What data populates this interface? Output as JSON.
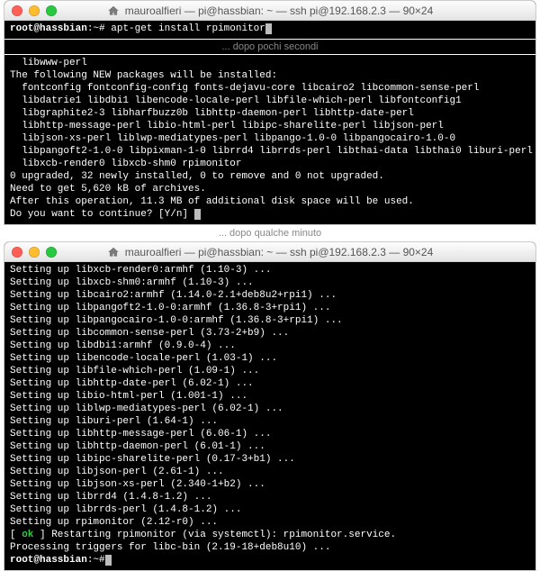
{
  "caption1": "... dopo pochi secondi",
  "caption2": "... dopo qualche minuto",
  "title1": "mauroalfieri — pi@hassbian: ~ — ssh pi@192.168.2.3 — 90×24",
  "title2": "mauroalfieri — pi@hassbian: ~ — ssh pi@192.168.2.3 — 90×24",
  "t1": {
    "prompt_user": "root@hassbian",
    "prompt_path": ":~#",
    "cmd": "apt-get install rpimonitor",
    "pkg_tail": "  libwww-perl",
    "new_hdr": "The following NEW packages will be installed:",
    "new1": "  fontconfig fontconfig-config fonts-dejavu-core libcairo2 libcommon-sense-perl",
    "new2": "  libdatrie1 libdbi1 libencode-locale-perl libfile-which-perl libfontconfig1",
    "new3": "  libgraphite2-3 libharfbuzz0b libhttp-daemon-perl libhttp-date-perl",
    "new4": "  libhttp-message-perl libio-html-perl libipc-sharelite-perl libjson-perl",
    "new5": "  libjson-xs-perl liblwp-mediatypes-perl libpango-1.0-0 libpangocairo-1.0-0",
    "new6": "  libpangoft2-1.0-0 libpixman-1-0 librrd4 librrds-perl libthai-data libthai0 liburi-perl",
    "new7": "  libxcb-render0 libxcb-shm0 rpimonitor",
    "upg": "0 upgraded, 32 newly installed, 0 to remove and 0 not upgraded.",
    "need": "Need to get 5,620 kB of archives.",
    "after": "After this operation, 11.3 MB of additional disk space will be used.",
    "cont": "Do you want to continue? [Y/n] "
  },
  "t2": {
    "l1": "Setting up libxcb-render0:armhf (1.10-3) ...",
    "l2": "Setting up libxcb-shm0:armhf (1.10-3) ...",
    "l3": "Setting up libcairo2:armhf (1.14.0-2.1+deb8u2+rpi1) ...",
    "l4": "Setting up libpangoft2-1.0-0:armhf (1.36.8-3+rpi1) ...",
    "l5": "Setting up libpangocairo-1.0-0:armhf (1.36.8-3+rpi1) ...",
    "l6": "Setting up libcommon-sense-perl (3.73-2+b9) ...",
    "l7": "Setting up libdbi1:armhf (0.9.0-4) ...",
    "l8": "Setting up libencode-locale-perl (1.03-1) ...",
    "l9": "Setting up libfile-which-perl (1.09-1) ...",
    "l10": "Setting up libhttp-date-perl (6.02-1) ...",
    "l11": "Setting up libio-html-perl (1.001-1) ...",
    "l12": "Setting up liblwp-mediatypes-perl (6.02-1) ...",
    "l13": "Setting up liburi-perl (1.64-1) ...",
    "l14": "Setting up libhttp-message-perl (6.06-1) ...",
    "l15": "Setting up libhttp-daemon-perl (6.01-1) ...",
    "l16": "Setting up libipc-sharelite-perl (0.17-3+b1) ...",
    "l17": "Setting up libjson-perl (2.61-1) ...",
    "l18": "Setting up libjson-xs-perl (2.340-1+b2) ...",
    "l19": "Setting up librrd4 (1.4.8-1.2) ...",
    "l20": "Setting up librrds-perl (1.4.8-1.2) ...",
    "l21": "Setting up rpimonitor (2.12-r0) ...",
    "restart_a": "[ ",
    "restart_ok": "ok",
    "restart_b": " ] Restarting rpimonitor (via systemctl): rpimonitor.service.",
    "trig": "Processing triggers for libc-bin (2.19-18+deb8u10) ...",
    "prompt_user": "root@hassbian",
    "prompt_path": ":~#"
  }
}
